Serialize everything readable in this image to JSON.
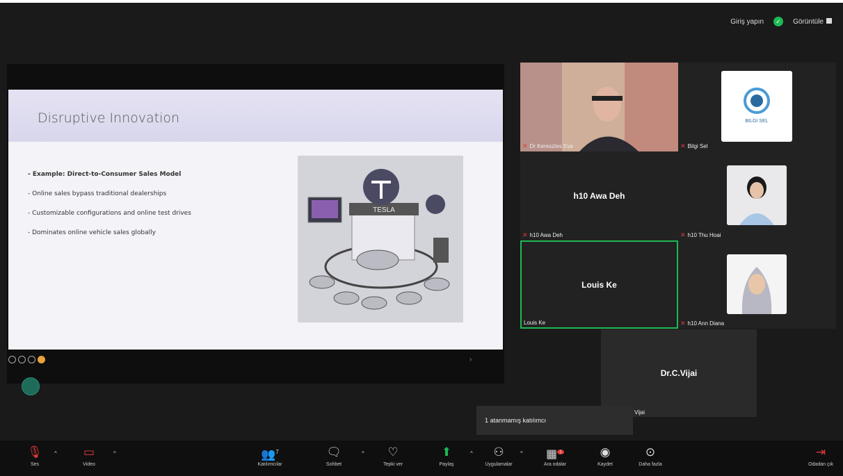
{
  "top_right": {
    "signin": "Giriş yapın",
    "view": "Görüntüle"
  },
  "slide": {
    "title": "Disruptive Innovation",
    "bullets": [
      "- Example: Direct-to-Consumer Sales Model",
      "- Online sales bypass traditional dealerships",
      "- Customizable configurations and online test drives",
      "- Dominates online vehicle sales globally"
    ],
    "image_sign": "TESLA"
  },
  "participants": {
    "p1": {
      "label": "Dr Keresztes Eva"
    },
    "p2": {
      "label": "Bilgi Sel",
      "logo_text": "BILGI SEL"
    },
    "p3": {
      "center": "h10 Awa Deh",
      "label": "h10 Awa Deh"
    },
    "p4": {
      "label": "h10 Thu Hoai"
    },
    "p5": {
      "center": "Louis Ke",
      "label": "Louis Ke"
    },
    "p6": {
      "label": "h10 Ann Diana"
    },
    "p7": {
      "center": "Dr.C.Vijai",
      "label": "Vijai"
    }
  },
  "tooltip": "1 atanmamış katılımcı",
  "toolbar": {
    "audio": "Ses",
    "video": "Video",
    "participants": "Katılımcılar",
    "participants_count": "7",
    "chat": "Sohbet",
    "react": "Tepki ver",
    "share": "Paylaş",
    "apps": "Uygulamalar",
    "breakout": "Ara odalar",
    "breakout_badge": "1",
    "record": "Kaydet",
    "more": "Daha fazla",
    "leave": "Odadan çık"
  },
  "colors": {
    "active_speaker": "#1db954",
    "mic_off": "#e23b3b",
    "share_green": "#1db954"
  }
}
